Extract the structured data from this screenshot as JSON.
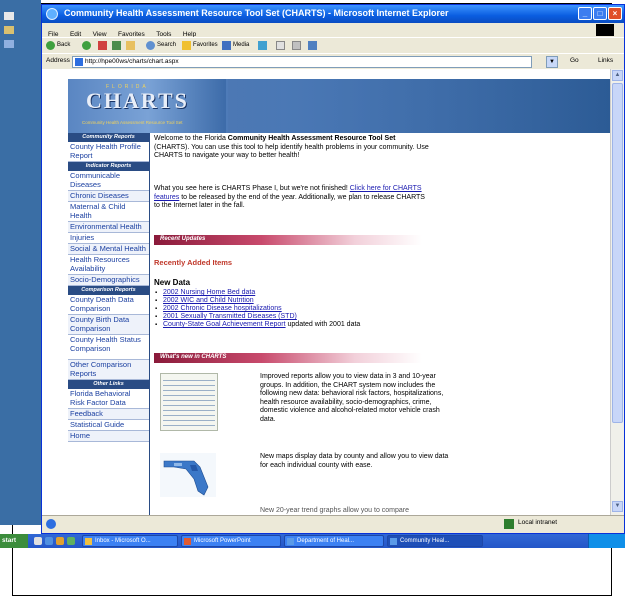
{
  "window": {
    "title": "Community Health Assessment Resource Tool Set (CHARTS) - Microsoft Internet Explorer"
  },
  "menu": [
    "File",
    "Edit",
    "View",
    "Favorites",
    "Tools",
    "Help"
  ],
  "toolbar": {
    "back": "Back",
    "search": "Search",
    "favorites": "Favorites",
    "media": "Media"
  },
  "address": {
    "label": "Address",
    "url": "http://hpe00ws/charts/chart.aspx",
    "go": "Go",
    "links": "Links"
  },
  "banner": {
    "state": "FLORIDA",
    "logo": "CHARTS",
    "tagline": "Community Health Assessment Resource Tool Set"
  },
  "nav": {
    "community_header": "Community Reports",
    "community_items": [
      "County Health Profile Report"
    ],
    "indicator_header": "Indicator Reports",
    "indicator_items": [
      "Communicable Diseases",
      "Chronic Diseases",
      "Maternal & Child Health",
      "Environmental Health",
      "Injuries",
      "Social & Mental Health",
      "Health Resources Availability",
      "Socio-Demographics"
    ],
    "comparison_header": "Comparison Reports",
    "comparison_items": [
      "County Death Data Comparison",
      "County Birth Data Comparison",
      "County Health Status Comparison",
      "Other Comparison Reports"
    ],
    "other_header": "Other Links",
    "other_items": [
      "Florida Behavioral Risk Factor Data",
      "Feedback",
      "Statistical Guide",
      "Home"
    ]
  },
  "welcome": {
    "prefix": "Welcome to the Florida ",
    "bold": "Community Health Assessment Resource Tool Set",
    "suffix": " (CHARTS). You can use this tool to help identify health problems in your community. Use CHARTS to navigate your way to better health!"
  },
  "phase": {
    "prefix": "What you see here is CHARTS Phase I, but we're not finished! ",
    "link": "Click here for CHARTS features",
    "suffix": " to be released by the end of the year. Additionally, we plan to release CHARTS to the Internet later in the fall."
  },
  "recent": {
    "header": "Recent Updates",
    "title": "Recently Added Items",
    "new_data": "New Data",
    "items": [
      {
        "link": "2002 Nursing Home Bed data",
        "suffix": ""
      },
      {
        "link": "2002 WIC and Child Nutrition",
        "suffix": ""
      },
      {
        "link": "2002 Chronic Disease hospitalizations",
        "suffix": ""
      },
      {
        "link": "2001 Sexually Transmitted Diseases (STD)",
        "suffix": ""
      },
      {
        "link": "County-State Goal Achievement Report",
        "suffix": " updated with 2001 data"
      }
    ]
  },
  "whatsnew": {
    "header": "What's new in CHARTS",
    "item1": "Improved reports allow you to view data in 3 and 10-year groups. In addition, the CHART system now includes the following new data: behavioral risk factors, hospitalizations, health resource availability, socio-demographics, crime, domestic violence and alcohol-related motor vehicle crash data.",
    "item2": "New maps display data by county and allow you to view data for each individual county with ease.",
    "item3": "New 20-year trend graphs allow you to compare"
  },
  "status": {
    "zone": "Local intranet"
  },
  "taskbar": {
    "start": "start",
    "tasks": [
      "Inbox - Microsoft O...",
      "Microsoft PowerPoint",
      "Department of Heal...",
      "Community Heal..."
    ]
  },
  "colors": {
    "nav_header": "#2a4c84",
    "section_bar": "#8a1a3a",
    "link": "#1a1ab0",
    "accent_red": "#c0392b"
  }
}
